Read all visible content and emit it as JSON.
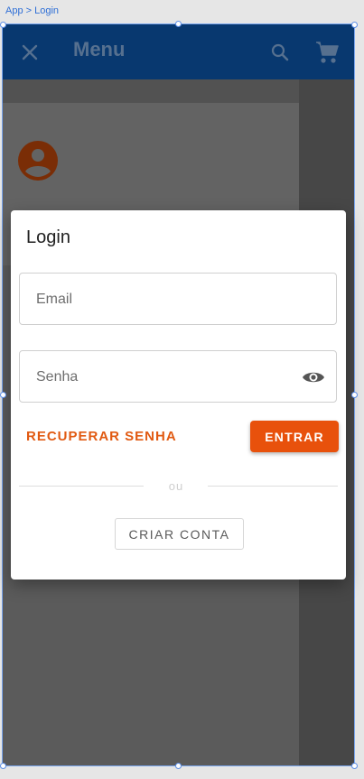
{
  "breadcrumb": "App > Login",
  "appbar": {
    "title": "Menu",
    "close_icon": "close-icon",
    "search_icon": "search-icon",
    "cart_icon": "cart-icon",
    "background": "#08386f"
  },
  "drawer": {
    "avatar_icon": "account-circle-icon",
    "avatar_color": "#7a2d06"
  },
  "dialog": {
    "title": "Login",
    "email_placeholder": "Email",
    "password_placeholder": "Senha",
    "password_toggle_icon": "eye-icon",
    "recover_label": "RECUPERAR SENHA",
    "submit_label": "ENTRAR",
    "or_label": "ou",
    "create_label": "CRIAR CONTA"
  },
  "colors": {
    "accent": "#e8510c",
    "link": "#e15a12",
    "selection": "#5b8ee6"
  }
}
